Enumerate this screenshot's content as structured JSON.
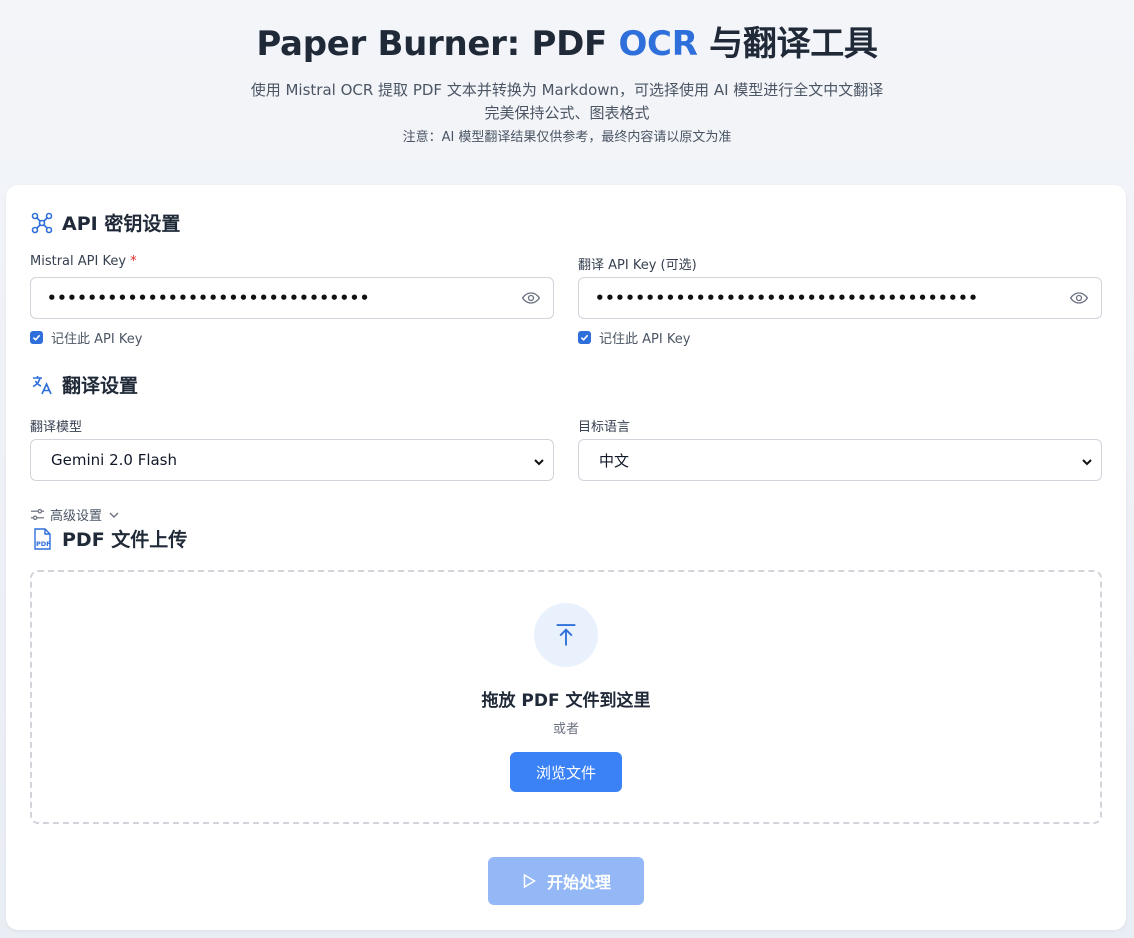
{
  "header": {
    "title_prefix": "Paper Burner: PDF ",
    "title_accent": "OCR",
    "title_suffix": " 与翻译工具",
    "subtitle_line1": "使用 Mistral OCR 提取 PDF 文本并转换为 Markdown，可选择使用 AI 模型进行全文中文翻译",
    "subtitle_line2": "完美保持公式、图表格式",
    "note": "注意：AI 模型翻译结果仅供参考，最终内容请以原文为准"
  },
  "api_section": {
    "title": "API 密钥设置",
    "icon": "network-icon",
    "mistral_label": "Mistral API Key",
    "required_mark": "*",
    "mistral_value": "••••••••••••••••••••••••••••••••",
    "mistral_remember": "记住此 API Key",
    "translate_label": "翻译 API Key (可选)",
    "translate_value": "••••••••••••••••••••••••••••••••••••••",
    "translate_remember": "记住此 API Key"
  },
  "translate_section": {
    "title": "翻译设置",
    "icon": "translate-icon",
    "model_label": "翻译模型",
    "model_value": "Gemini 2.0 Flash",
    "lang_label": "目标语言",
    "lang_value": "中文"
  },
  "advanced": {
    "label": "高级设置"
  },
  "upload_section": {
    "title": "PDF 文件上传",
    "icon": "pdf-file-icon",
    "drop_text": "拖放 PDF 文件到这里",
    "or_text": "或者",
    "browse_label": "浏览文件"
  },
  "actions": {
    "start_label": "开始处理"
  },
  "colors": {
    "accent": "#2f6fdb",
    "button": "#3b82f6",
    "button_disabled": "#93b8f5"
  }
}
